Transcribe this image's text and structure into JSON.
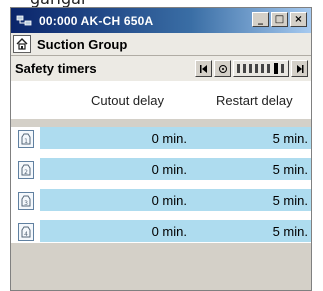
{
  "crop_text": "garigar",
  "window": {
    "title": "00:000 AK-CH 650A",
    "buttons": {
      "minimize": "_",
      "maximize": "□",
      "close": "×"
    }
  },
  "group": {
    "title": "Suction Group"
  },
  "section": {
    "title": "Safety timers"
  },
  "columns": {
    "cutout": "Cutout delay",
    "restart": "Restart delay"
  },
  "rows": [
    {
      "id": "1",
      "cutout": "0 min.",
      "restart": "5 min."
    },
    {
      "id": "2",
      "cutout": "0 min.",
      "restart": "5 min."
    },
    {
      "id": "3",
      "cutout": "0 min.",
      "restart": "5 min."
    },
    {
      "id": "4",
      "cutout": "0 min.",
      "restart": "5 min."
    }
  ],
  "colors": {
    "title_bar_start": "#0a246a",
    "row_highlight": "#aedcef",
    "chrome": "#d4d0c8"
  },
  "icons": {
    "app": "network-icon",
    "home": "home-icon",
    "first": "first-page-icon",
    "reset": "reset-icon",
    "slider": "slider-icon",
    "next": "next-page-icon",
    "row": "compressor-icon"
  }
}
